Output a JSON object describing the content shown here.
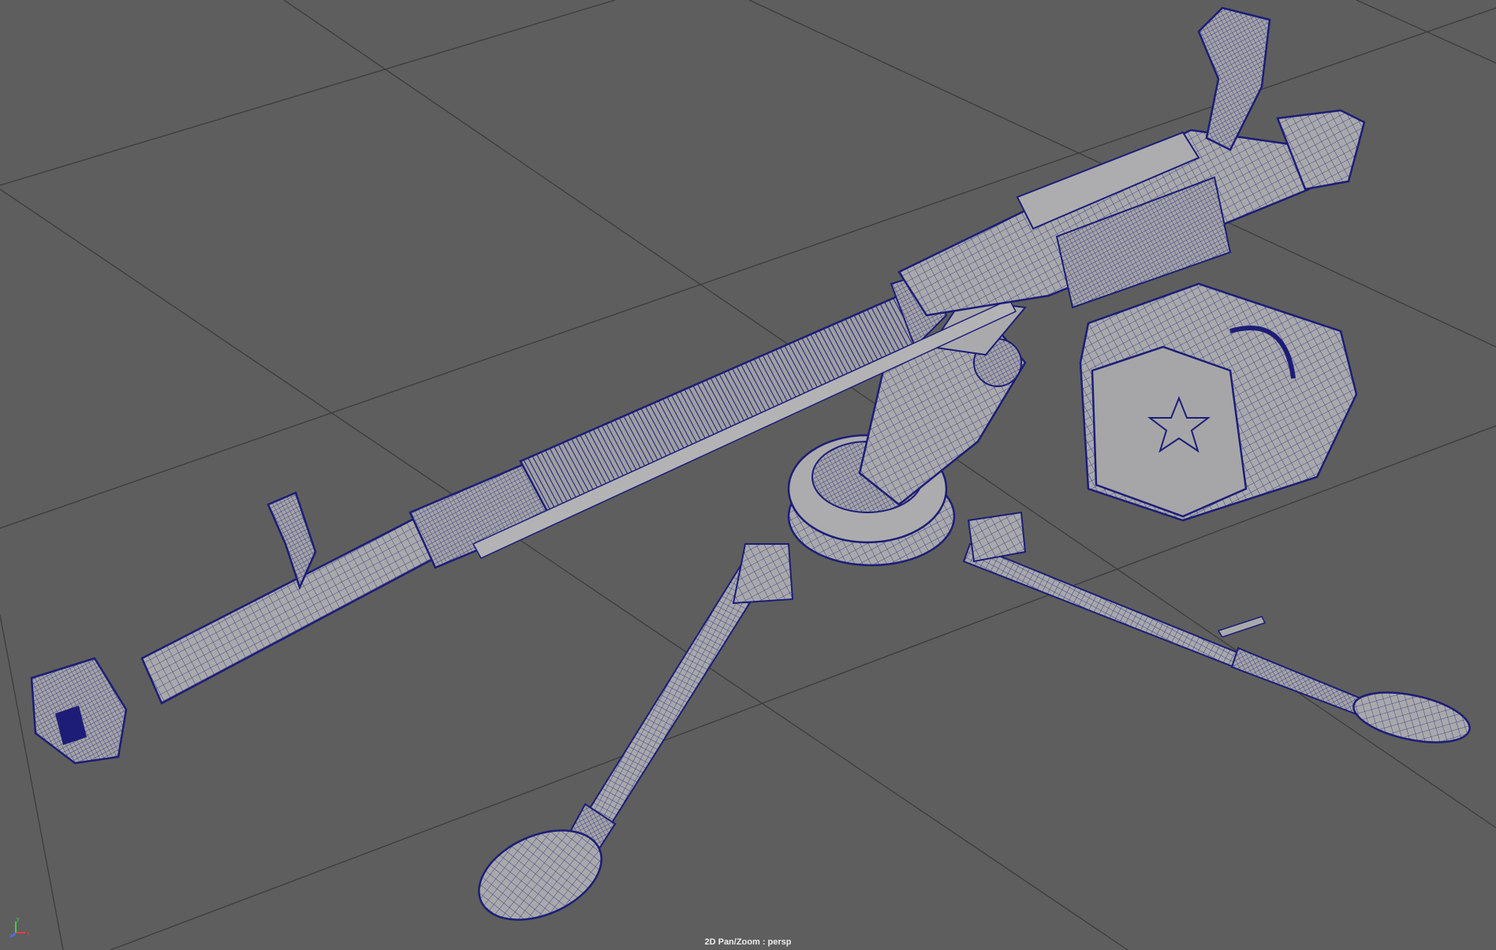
{
  "viewport": {
    "camera": "persp",
    "hud_label": "2D Pan/Zoom : persp",
    "shading": "wireframe-on-shaded",
    "background_color": "#5e5e5e",
    "grid_color": "#3c3c3c",
    "mesh_fill_color": "#a9a9ab",
    "wire_color": "#1e1e7a"
  },
  "axis_gizmo": {
    "x_label": "x",
    "y_label": "y",
    "z_label": "z",
    "x_color": "#e04040",
    "y_color": "#40d040",
    "z_color": "#5070ff"
  }
}
